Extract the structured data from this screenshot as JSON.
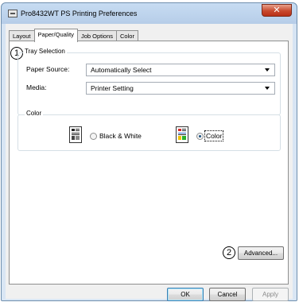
{
  "window": {
    "title": "Pro8432WT PS Printing Preferences",
    "close_glyph": "✕"
  },
  "tabs": [
    {
      "label": "Layout"
    },
    {
      "label": "Paper/Quality",
      "active": true
    },
    {
      "label": "Job Options"
    },
    {
      "label": "Color"
    }
  ],
  "tray_selection": {
    "callout": "1",
    "title": "Tray Selection",
    "paper_source_label": "Paper Source:",
    "paper_source_value": "Automatically Select",
    "media_label": "Media:",
    "media_value": "Printer Setting"
  },
  "color_group": {
    "title": "Color",
    "bw_label": "Black & White",
    "color_label": "Color",
    "selected": "color"
  },
  "advanced": {
    "callout": "2",
    "label": "Advanced..."
  },
  "buttons": {
    "ok": "OK",
    "cancel": "Cancel",
    "apply": "Apply"
  },
  "icons": {
    "app": "printer-icon",
    "bw": "bw-document-icon",
    "color": "color-document-icon"
  },
  "colors": {
    "close_button": "#c84a2e",
    "title_bar": "#c7dcf2",
    "dialog_bg": "#f0f0f0"
  }
}
